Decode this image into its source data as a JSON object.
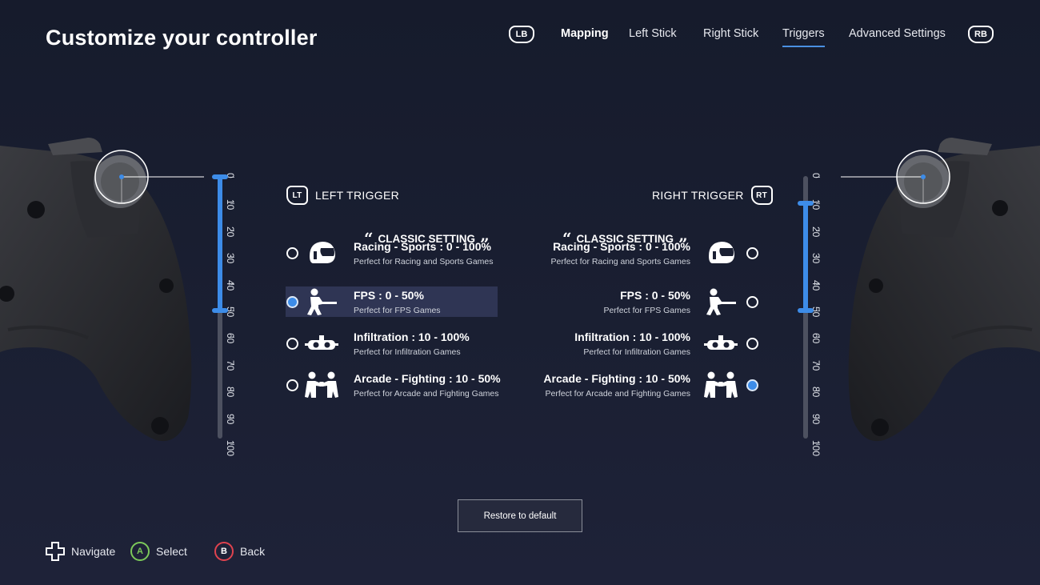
{
  "page_title": "Customize your controller",
  "nav": {
    "lb": "LB",
    "rb": "RB",
    "tabs": [
      {
        "label": "Mapping"
      },
      {
        "label": "Left Stick"
      },
      {
        "label": "Right Stick"
      },
      {
        "label": "Triggers",
        "active": true
      },
      {
        "label": "Advanced Settings"
      }
    ]
  },
  "scale_labels": [
    "0",
    "10",
    "20",
    "30",
    "40",
    "50",
    "60",
    "70",
    "80",
    "90",
    "100"
  ],
  "left_trigger": {
    "badge": "LT",
    "title": "LEFT TRIGGER",
    "range_percent": [
      0,
      50
    ],
    "classic_label": "CLASSIC SETTING",
    "options": [
      {
        "name": "Racing - Sports : 0 - 100%",
        "desc": "Perfect for Racing and Sports Games",
        "icon": "racing-helmet-icon",
        "selected": false
      },
      {
        "name": "FPS : 0 - 50%",
        "desc": "Perfect for FPS Games",
        "icon": "fps-shooter-icon",
        "selected": true
      },
      {
        "name": "Infiltration : 10 - 100%",
        "desc": "Perfect for Infiltration Games",
        "icon": "night-vision-goggles-icon",
        "selected": false
      },
      {
        "name": "Arcade - Fighting : 10 - 50%",
        "desc": "Perfect for Arcade and Fighting Games",
        "icon": "fighters-icon",
        "selected": false
      }
    ]
  },
  "right_trigger": {
    "badge": "RT",
    "title": "RIGHT TRIGGER",
    "range_percent": [
      10,
      50
    ],
    "classic_label": "CLASSIC SETTING",
    "options": [
      {
        "name": "Racing - Sports : 0 - 100%",
        "desc": "Perfect for Racing and Sports Games",
        "icon": "racing-helmet-icon",
        "selected": false
      },
      {
        "name": "FPS : 0 - 50%",
        "desc": "Perfect for FPS Games",
        "icon": "fps-shooter-icon",
        "selected": false
      },
      {
        "name": "Infiltration : 10 - 100%",
        "desc": "Perfect for Infiltration Games",
        "icon": "night-vision-goggles-icon",
        "selected": false
      },
      {
        "name": "Arcade - Fighting : 10 - 50%",
        "desc": "Perfect for Arcade and Fighting Games",
        "icon": "fighters-icon",
        "selected": true
      }
    ]
  },
  "restore_label": "Restore to default",
  "hints": [
    {
      "label": "Navigate",
      "icon": "dpad-icon"
    },
    {
      "key": "A",
      "label": "Select",
      "color": "#7cc95a"
    },
    {
      "key": "B",
      "label": "Back",
      "color": "#e0434f"
    }
  ],
  "colors": {
    "accent": "#3d8ce8",
    "selected_row": "#2f3554"
  }
}
